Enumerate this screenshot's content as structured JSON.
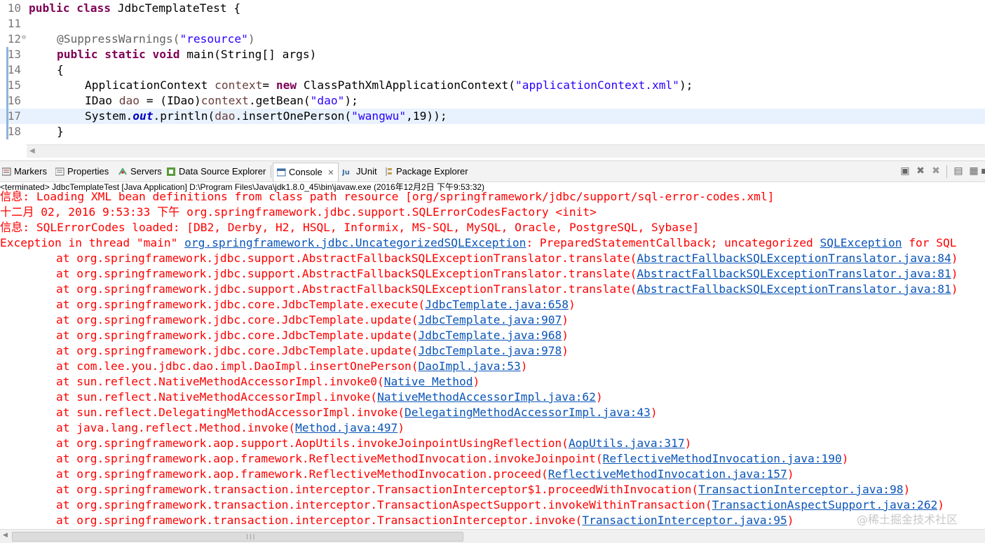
{
  "editor": {
    "line_numbers": [
      "10",
      "11",
      "12",
      "13",
      "14",
      "15",
      "16",
      "17",
      "18"
    ],
    "lines": [
      [
        {
          "t": "public",
          "c": "kw"
        },
        {
          "t": " "
        },
        {
          "t": "class",
          "c": "kw"
        },
        {
          "t": " JdbcTemplateTest {"
        }
      ],
      [],
      [
        {
          "t": "@SuppressWarnings(",
          "c": "ann"
        },
        {
          "t": "\"resource\"",
          "c": "str"
        },
        {
          "t": ")",
          "c": "ann"
        }
      ],
      [
        {
          "t": "public",
          "c": "kw"
        },
        {
          "t": " "
        },
        {
          "t": "static",
          "c": "kw"
        },
        {
          "t": " "
        },
        {
          "t": "void",
          "c": "kw"
        },
        {
          "t": " main(String[] args)"
        }
      ],
      [
        {
          "t": "{"
        }
      ],
      [
        {
          "t": "ApplicationContext "
        },
        {
          "t": "context",
          "c": "var"
        },
        {
          "t": "= "
        },
        {
          "t": "new",
          "c": "kw"
        },
        {
          "t": " ClassPathXmlApplicationContext("
        },
        {
          "t": "\"applicationContext.xml\"",
          "c": "str"
        },
        {
          "t": ");"
        }
      ],
      [
        {
          "t": "IDao "
        },
        {
          "t": "dao",
          "c": "var"
        },
        {
          "t": " = (IDao)"
        },
        {
          "t": "context",
          "c": "var"
        },
        {
          "t": ".getBean("
        },
        {
          "t": "\"dao\"",
          "c": "str"
        },
        {
          "t": ");"
        }
      ],
      [
        {
          "t": "System."
        },
        {
          "t": "out",
          "c": "fld"
        },
        {
          "t": ".println("
        },
        {
          "t": "dao",
          "c": "var"
        },
        {
          "t": ".insertOnePerson("
        },
        {
          "t": "\"wangwu\"",
          "c": "str"
        },
        {
          "t": ",19));"
        }
      ],
      [
        {
          "t": "}"
        }
      ]
    ]
  },
  "tabs": [
    {
      "label": "Markers",
      "icon": "markers-icon"
    },
    {
      "label": "Properties",
      "icon": "properties-icon"
    },
    {
      "label": "Servers",
      "icon": "servers-icon"
    },
    {
      "label": "Data Source Explorer",
      "icon": "data-source-icon"
    },
    {
      "label": "Console",
      "icon": "console-icon",
      "active": true
    },
    {
      "label": "JUnit",
      "icon": "junit-icon"
    },
    {
      "label": "Package Explorer",
      "icon": "package-explorer-icon"
    }
  ],
  "toolbar_icons": [
    "minimize-icon",
    "terminate-icon",
    "remove-all-terminated-icon",
    "scroll-lock-icon",
    "pin-console-icon",
    "display-selected-console-icon",
    "open-console-icon"
  ],
  "status_line": "<terminated> JdbcTemplateTest [Java Application] D:\\Program Files\\Java\\jdk1.8.0_45\\bin\\javaw.exe (2016年12月2日 下午9:53:32)",
  "console_lines": [
    {
      "text": "信息: Loading XML bean definitions from class path resource [org/springframework/jdbc/support/sql-error-codes.xml]"
    },
    {
      "text": "十二月 02, 2016 9:53:33 下午 org.springframework.jdbc.support.SQLErrorCodesFactory <init>"
    },
    {
      "text": "信息: SQLErrorCodes loaded: [DB2, Derby, H2, HSQL, Informix, MS-SQL, MySQL, Oracle, PostgreSQL, Sybase]"
    },
    {
      "parts": [
        {
          "t": "Exception in thread \"main\" "
        },
        {
          "t": "org.springframework.jdbc.UncategorizedSQLException",
          "link": true
        },
        {
          "t": ": PreparedStatementCallback; uncategorized "
        },
        {
          "t": "SQLException",
          "link": true
        },
        {
          "t": " for SQL"
        }
      ]
    },
    {
      "indent": true,
      "prefix": "at org.springframework.jdbc.support.AbstractFallbackSQLExceptionTranslator.translate(",
      "link": "AbstractFallbackSQLExceptionTranslator.java:84",
      "suffix": ")"
    },
    {
      "indent": true,
      "prefix": "at org.springframework.jdbc.support.AbstractFallbackSQLExceptionTranslator.translate(",
      "link": "AbstractFallbackSQLExceptionTranslator.java:81",
      "suffix": ")"
    },
    {
      "indent": true,
      "prefix": "at org.springframework.jdbc.support.AbstractFallbackSQLExceptionTranslator.translate(",
      "link": "AbstractFallbackSQLExceptionTranslator.java:81",
      "suffix": ")"
    },
    {
      "indent": true,
      "prefix": "at org.springframework.jdbc.core.JdbcTemplate.execute(",
      "link": "JdbcTemplate.java:658",
      "suffix": ")"
    },
    {
      "indent": true,
      "prefix": "at org.springframework.jdbc.core.JdbcTemplate.update(",
      "link": "JdbcTemplate.java:907",
      "suffix": ")"
    },
    {
      "indent": true,
      "prefix": "at org.springframework.jdbc.core.JdbcTemplate.update(",
      "link": "JdbcTemplate.java:968",
      "suffix": ")"
    },
    {
      "indent": true,
      "prefix": "at org.springframework.jdbc.core.JdbcTemplate.update(",
      "link": "JdbcTemplate.java:978",
      "suffix": ")"
    },
    {
      "indent": true,
      "prefix": "at com.lee.you.jdbc.dao.impl.DaoImpl.insertOnePerson(",
      "link": "DaoImpl.java:53",
      "suffix": ")"
    },
    {
      "indent": true,
      "prefix": "at sun.reflect.NativeMethodAccessorImpl.invoke0(",
      "link": "Native Method",
      "suffix": ")"
    },
    {
      "indent": true,
      "prefix": "at sun.reflect.NativeMethodAccessorImpl.invoke(",
      "link": "NativeMethodAccessorImpl.java:62",
      "suffix": ")"
    },
    {
      "indent": true,
      "prefix": "at sun.reflect.DelegatingMethodAccessorImpl.invoke(",
      "link": "DelegatingMethodAccessorImpl.java:43",
      "suffix": ")"
    },
    {
      "indent": true,
      "prefix": "at java.lang.reflect.Method.invoke(",
      "link": "Method.java:497",
      "suffix": ")"
    },
    {
      "indent": true,
      "prefix": "at org.springframework.aop.support.AopUtils.invokeJoinpointUsingReflection(",
      "link": "AopUtils.java:317",
      "suffix": ")"
    },
    {
      "indent": true,
      "prefix": "at org.springframework.aop.framework.ReflectiveMethodInvocation.invokeJoinpoint(",
      "link": "ReflectiveMethodInvocation.java:190",
      "suffix": ")"
    },
    {
      "indent": true,
      "prefix": "at org.springframework.aop.framework.ReflectiveMethodInvocation.proceed(",
      "link": "ReflectiveMethodInvocation.java:157",
      "suffix": ")"
    },
    {
      "indent": true,
      "prefix": "at org.springframework.transaction.interceptor.TransactionInterceptor$1.proceedWithInvocation(",
      "link": "TransactionInterceptor.java:98",
      "suffix": ")"
    },
    {
      "indent": true,
      "prefix": "at org.springframework.transaction.interceptor.TransactionAspectSupport.invokeWithinTransaction(",
      "link": "TransactionAspectSupport.java:262",
      "suffix": ")"
    },
    {
      "indent": true,
      "prefix": "at org.springframework.transaction.interceptor.TransactionInterceptor.invoke(",
      "link": "TransactionInterceptor.java:95",
      "suffix": ")"
    }
  ],
  "watermark": "@稀土掘金技术社区",
  "colors": {
    "console_error": "#ff0000",
    "link": "#0a55b8",
    "keyword": "#7f0055",
    "string": "#2a00ff",
    "current_line": "#e8f2fe"
  }
}
